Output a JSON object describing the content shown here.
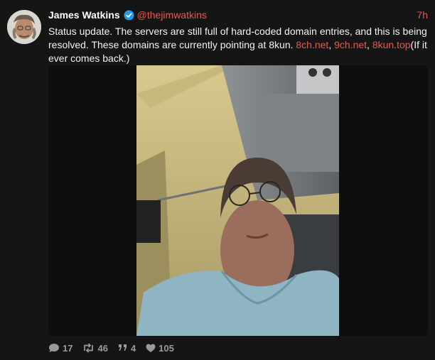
{
  "tweet": {
    "author_name": "James Watkins",
    "handle": "@thejimwatkins",
    "time": "7h",
    "text_parts": [
      "Status update. The servers are still full of hard-coded domain entries, and this is being resolved. These domains are currently pointing at 8kun. ",
      "8ch.net",
      ", ",
      "9ch.net",
      ", ",
      "8kun.top",
      "(If it ever comes back.)"
    ]
  },
  "stats": {
    "replies": "17",
    "retweets": "46",
    "quotes": "4",
    "likes": "105"
  },
  "icons": {
    "reply": "speech-bubble-icon",
    "retweet": "retweet-icon",
    "quote": "quote-icon",
    "like": "heart-icon",
    "verified": "verified-badge-icon"
  },
  "colors": {
    "accent": "#e8584f",
    "background": "#151515",
    "verified": "#1d9bf0"
  }
}
